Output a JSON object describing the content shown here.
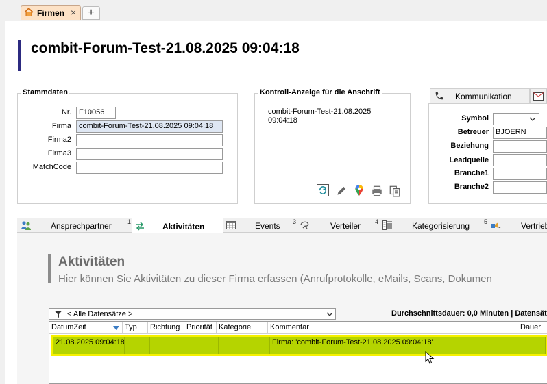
{
  "tabs": {
    "document_tab_label": "Firmen",
    "close_glyph": "×",
    "new_tab_glyph": "+"
  },
  "page": {
    "title": "combit-Forum-Test-21.08.2025 09:04:18"
  },
  "stammdaten": {
    "title": "Stammdaten",
    "fields": [
      {
        "label": "Nr.",
        "value": "F10056"
      },
      {
        "label": "Firma",
        "value": "combit-Forum-Test-21.08.2025 09:04:18"
      },
      {
        "label": "Firma2",
        "value": ""
      },
      {
        "label": "Firma3",
        "value": ""
      },
      {
        "label": "MatchCode",
        "value": ""
      }
    ]
  },
  "kontroll": {
    "title": "Kontroll-Anzeige für die Anschrift",
    "line1": "combit-Forum-Test-21.08.2025",
    "line2": "09:04:18",
    "tools": [
      "refresh-icon",
      "pen-icon",
      "map-pin-icon",
      "printer-icon",
      "copy-icon"
    ]
  },
  "kommunikation": {
    "tab_label": "Kommunikation",
    "fields": [
      {
        "label": "Symbol",
        "value": ""
      },
      {
        "label": "Betreuer",
        "value": "BJOERN"
      },
      {
        "label": "Beziehung",
        "value": ""
      },
      {
        "label": "Leadquelle",
        "value": ""
      },
      {
        "label": "Branche1",
        "value": ""
      },
      {
        "label": "Branche2",
        "value": ""
      }
    ]
  },
  "lower_tabs": [
    {
      "label": "Ansprechpartner",
      "num": "1",
      "icon": "people-icon"
    },
    {
      "label": "Aktivitäten",
      "num": "",
      "icon": "arrows-exchange-icon",
      "active": true
    },
    {
      "label": "Events",
      "num": "3",
      "icon": "calendar-grid-icon"
    },
    {
      "label": "Verteiler",
      "num": "4",
      "icon": "distribution-icon"
    },
    {
      "label": "Kategorisierung",
      "num": "5",
      "icon": "category-list-icon"
    },
    {
      "label": "Vertrieb",
      "num": "",
      "icon": "sales-icon"
    }
  ],
  "activities": {
    "title": "Aktivitäten",
    "subtitle": "Hier können Sie Aktivitäten zu dieser Firma erfassen (Anrufprotokolle, eMails, Scans, Dokumen",
    "filter_label": "< Alle Datensätze >",
    "stats": "Durchschnittsdauer: 0,0 Minuten | Datensät",
    "columns": [
      "DatumZeit",
      "Typ",
      "Richtung",
      "Priorität",
      "Kategorie",
      "Kommentar",
      "Dauer"
    ],
    "rows": [
      {
        "DatumZeit": "21.08.2025 09:04:18",
        "Typ": "",
        "Richtung": "",
        "Priorität": "",
        "Kategorie": "",
        "Kommentar": "Firma: 'combit-Forum-Test-21.08.2025 09:04:18'",
        "Dauer": ""
      }
    ]
  },
  "colors": {
    "accent_bar": "#2c2a80",
    "selected_row": "#b5d400",
    "row_highlight_border": "#f5f000",
    "doc_tab_bg": "#fde2c6"
  }
}
